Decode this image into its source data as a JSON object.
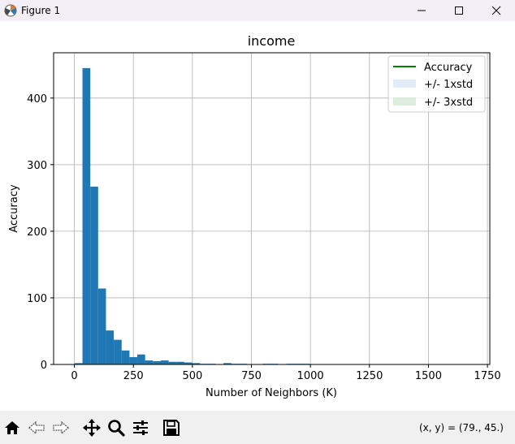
{
  "window": {
    "title": "Figure 1",
    "icon": "matplotlib-icon"
  },
  "toolbar": {
    "buttons": [
      {
        "name": "home-icon"
      },
      {
        "name": "back-arrow-icon"
      },
      {
        "name": "forward-arrow-icon"
      },
      {
        "name": "pan-icon"
      },
      {
        "name": "zoom-icon"
      },
      {
        "name": "configure-subplots-icon"
      },
      {
        "name": "save-icon"
      }
    ],
    "coords": "(x, y) = (79., 45.)"
  },
  "chart_data": {
    "type": "bar",
    "title": "income",
    "xlabel": "Number of Neighbors (K)",
    "ylabel": "Accuracy",
    "xlim": [
      -88,
      1760
    ],
    "ylim": [
      0,
      468
    ],
    "xticks": [
      0,
      250,
      500,
      750,
      1000,
      1250,
      1500,
      1750
    ],
    "yticks": [
      0,
      100,
      200,
      300,
      400
    ],
    "grid": true,
    "bar_color": "#1f77b4",
    "bin_width": 33.2,
    "bins_start": 1,
    "values": [
      2,
      445,
      267,
      114,
      51,
      37,
      21,
      11,
      15,
      6,
      5,
      6,
      4,
      4,
      3,
      2,
      1,
      1,
      0,
      2,
      1,
      1,
      0,
      0,
      1,
      1,
      0,
      1,
      1,
      1,
      0,
      0,
      0,
      0,
      0,
      0,
      0,
      0,
      0,
      0,
      0,
      0,
      0,
      0,
      0,
      0,
      0,
      0,
      0,
      0
    ],
    "legend": {
      "placement": "top-right",
      "entries": [
        {
          "label": "Accuracy",
          "type": "line",
          "color": "#008000"
        },
        {
          "label": "+/- 1xstd",
          "type": "patch",
          "color": "#cfe0f2"
        },
        {
          "label": "+/- 3xstd",
          "type": "patch",
          "color": "#cfe5cf"
        }
      ]
    }
  }
}
